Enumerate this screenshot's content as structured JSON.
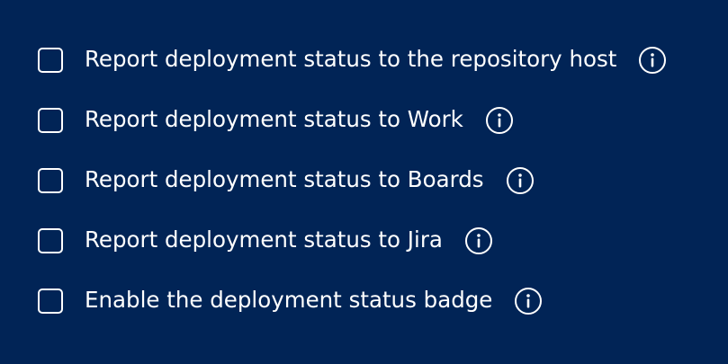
{
  "options": [
    {
      "label": "Report deployment status to the repository host",
      "checked": false,
      "icon": "info-icon"
    },
    {
      "label": "Report deployment status to Work",
      "checked": false,
      "icon": "info-icon"
    },
    {
      "label": "Report deployment status to Boards",
      "checked": false,
      "icon": "info-icon"
    },
    {
      "label": "Report deployment status to Jira",
      "checked": false,
      "icon": "info-icon"
    },
    {
      "label": "Enable the deployment status badge",
      "checked": false,
      "icon": "info-icon"
    }
  ],
  "colors": {
    "background": "#012456",
    "foreground": "#ffffff"
  }
}
